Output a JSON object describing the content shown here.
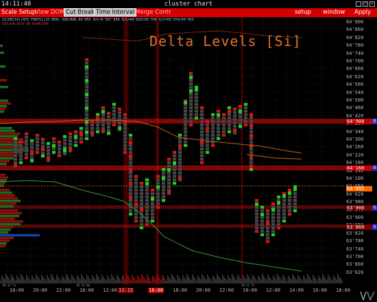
{
  "window": {
    "clock": "14:11:40",
    "title": "cluster chart",
    "min_icon": "minimize-icon",
    "max_icon": "maximize-icon",
    "close_icon": "close-icon"
  },
  "menu": {
    "scale_setup": "Scale Setup",
    "view_dom": "View DOM",
    "cut_breaks": "Cut Breaks",
    "time_interval": "Time Interval",
    "merge_contr": "Merge Contr",
    "setup": "setup",
    "window": "window",
    "apply": "Apply"
  },
  "instrument": {
    "headline": "SI(DEC16)(RTS FORTS)(15 MIN) USD/RUR  64'055  Vol=9'567'658  H/L=64'820/63'760  O/C=63'974/64'055",
    "subline": "BID=ASK=VIEW ON AGGRESSOR",
    "overlay_title": "Delta Levels [Si]"
  },
  "price_axis": {
    "ticks": [
      {
        "label": "64'900"
      },
      {
        "label": "64'880"
      },
      {
        "label": "64'860"
      },
      {
        "label": "64'840"
      },
      {
        "label": "64'820"
      },
      {
        "label": "64'800"
      },
      {
        "label": "64'780"
      },
      {
        "label": "64'760"
      },
      {
        "label": "64'740"
      },
      {
        "label": "64'720"
      },
      {
        "label": "64'700"
      },
      {
        "label": "64'680"
      },
      {
        "label": "64'660"
      },
      {
        "label": "64'640"
      },
      {
        "label": "64'620"
      },
      {
        "label": "64'600"
      },
      {
        "label": "64'580"
      },
      {
        "label": "64'560"
      },
      {
        "label": "64'540"
      },
      {
        "label": "64'520"
      },
      {
        "label": "64'500"
      },
      {
        "label": "64'480"
      },
      {
        "label": "64'460"
      },
      {
        "label": "64'440"
      },
      {
        "label": "64'420"
      },
      {
        "label": "64'400"
      },
      {
        "label": "64'380"
      },
      {
        "label": "64'360"
      },
      {
        "label": "64'340"
      },
      {
        "label": "64'320"
      },
      {
        "label": "64'300"
      },
      {
        "label": "64'280"
      },
      {
        "label": "64'260"
      },
      {
        "label": "64'240"
      },
      {
        "label": "64'220"
      },
      {
        "label": "64'200"
      },
      {
        "label": "64'180"
      },
      {
        "label": "64'160"
      },
      {
        "label": "64'140"
      },
      {
        "label": "64'120"
      },
      {
        "label": "64'100"
      },
      {
        "label": "64'080"
      },
      {
        "label": "64'060"
      },
      {
        "label": "64'040"
      },
      {
        "label": "64'020"
      },
      {
        "label": "64'000"
      },
      {
        "label": "63'980"
      },
      {
        "label": "63'960"
      },
      {
        "label": "63'940"
      },
      {
        "label": "63'920"
      },
      {
        "label": "63'900"
      },
      {
        "label": "63'880"
      },
      {
        "label": "63'860"
      },
      {
        "label": "63'840"
      },
      {
        "label": "63'820"
      },
      {
        "label": "63'800"
      },
      {
        "label": "63'780"
      },
      {
        "label": "63'760"
      },
      {
        "label": "63'740"
      },
      {
        "label": "63'720"
      },
      {
        "label": "63'700"
      },
      {
        "label": "63'680"
      },
      {
        "label": "63'660"
      },
      {
        "label": "63'640"
      },
      {
        "label": "63'620"
      },
      {
        "label": "63'600"
      }
    ],
    "levels": [
      {
        "label": "64'900",
        "badge": "D",
        "color": "#c40000"
      },
      {
        "label": "64'160",
        "badge": "D",
        "color": "#c40000"
      },
      {
        "label": "64'055",
        "badge": "",
        "color": "#ff6a00"
      },
      {
        "label": "63'900",
        "badge": "G",
        "color": "#7a0000"
      },
      {
        "label": "63'860",
        "badge": "G",
        "color": "#7a0000"
      }
    ]
  },
  "time_axis": {
    "ticks": [
      {
        "label": "18:00",
        "style": ""
      },
      {
        "label": "20:00",
        "style": ""
      },
      {
        "label": "22:00",
        "style": ""
      },
      {
        "label": "10:00",
        "style": ""
      },
      {
        "label": "12:00",
        "style": ""
      },
      {
        "label": "13:15",
        "style": "hl2"
      },
      {
        "label": "16:00",
        "style": "hl"
      },
      {
        "label": "18:00",
        "style": ""
      },
      {
        "label": "20:00",
        "style": ""
      },
      {
        "label": "22:00",
        "style": ""
      },
      {
        "label": "10:00",
        "style": ""
      },
      {
        "label": "12:00",
        "style": ""
      },
      {
        "label": "14:00",
        "style": ""
      },
      {
        "label": "16:00",
        "style": ""
      },
      {
        "label": "18:00",
        "style": ""
      }
    ],
    "date_labels": [
      "06.12 Tu",
      "05.12 We",
      "10.11 Th"
    ]
  },
  "colors": {
    "bid_green": "#22cc22",
    "ask_red": "#dd1111",
    "neutral_cell": "#4a4a4a",
    "level_red": "#c40000",
    "vwap_orange": "#c06020",
    "lower_band_green": "#3a9a3a"
  }
}
